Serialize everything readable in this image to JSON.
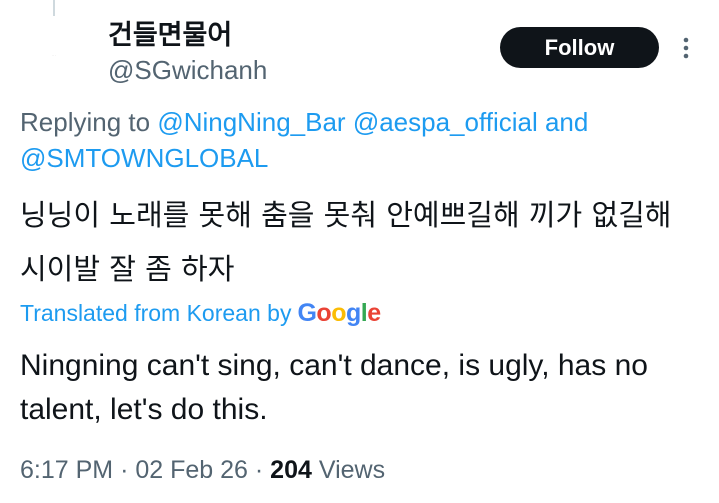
{
  "author": {
    "display_name": "건들면물어",
    "handle": "@SGwichanh",
    "avatar_text": "..."
  },
  "actions": {
    "follow_label": "Follow",
    "more_icon": "more-vertical-icon"
  },
  "reply": {
    "prefix": "Replying to",
    "mentions": [
      "@NingNing_Bar",
      "@aespa_official"
    ],
    "conjunction": "and",
    "last_mention": "@SMTOWNGLOBAL"
  },
  "tweet": {
    "text": "닝닝이 노래를 못해 춤을 못춰 안예쁘길해 끼가 없길해 시이발 잘 좀 하자",
    "translated_label": "Translated from Korean by",
    "translator": "Google",
    "translation": "Ningning can't sing, can't dance, is ugly, has no talent, let's do this."
  },
  "meta": {
    "time": "6:17 PM",
    "separator": "·",
    "date": "02 Feb 26",
    "views_count": "204",
    "views_label": "Views"
  },
  "colors": {
    "accent": "#1d9bf0",
    "text": "#0f1419",
    "muted": "#536471",
    "google_blue": "#4285F4",
    "google_red": "#EA4335",
    "google_yellow": "#FBBC05",
    "google_green": "#34A853"
  }
}
